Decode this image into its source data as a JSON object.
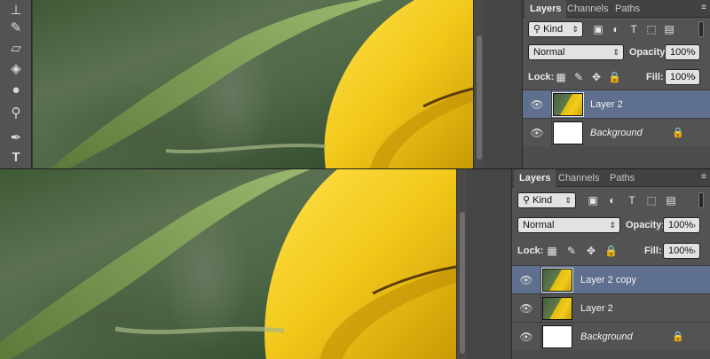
{
  "top_view": {
    "tools": [
      {
        "name": "stamp-icon",
        "glyph": "⊥"
      },
      {
        "name": "history-brush-icon",
        "glyph": "✎"
      },
      {
        "name": "eraser-icon",
        "glyph": "▱"
      },
      {
        "name": "paint-bucket-icon",
        "glyph": "⛽"
      },
      {
        "name": "blur-icon",
        "glyph": "💧"
      },
      {
        "name": "dodge-icon",
        "glyph": "🔍"
      },
      {
        "name": "pen-icon",
        "glyph": "✒"
      },
      {
        "name": "type-icon",
        "glyph": "T"
      }
    ],
    "layers_panel": {
      "tabs": [
        "Layers",
        "Channels",
        "Paths"
      ],
      "filter_label": "Kind",
      "blend_mode": "Normal",
      "opacity_label": "Opacity:",
      "opacity_value": "100%",
      "lock_label": "Lock:",
      "fill_label": "Fill:",
      "fill_value": "100%",
      "layers": [
        {
          "name": "Layer 2",
          "selected": true,
          "thumbnail": "photo",
          "italic": false,
          "locked": false
        },
        {
          "name": "Background",
          "selected": false,
          "thumbnail": "white",
          "italic": true,
          "locked": true
        }
      ]
    }
  },
  "bottom_view": {
    "layers_panel": {
      "tabs": [
        "Layers",
        "Channels",
        "Paths"
      ],
      "filter_label": "Kind",
      "blend_mode": "Normal",
      "opacity_label": "Opacity:",
      "opacity_value": "100%",
      "lock_label": "Lock:",
      "fill_label": "Fill:",
      "fill_value": "100%",
      "layers": [
        {
          "name": "Layer 2 copy",
          "selected": true,
          "thumbnail": "photo",
          "italic": false,
          "locked": false
        },
        {
          "name": "Layer 2",
          "selected": false,
          "thumbnail": "photo",
          "italic": false,
          "locked": false
        },
        {
          "name": "Background",
          "selected": false,
          "thumbnail": "white",
          "italic": true,
          "locked": true
        }
      ]
    }
  },
  "colors": {
    "panel_bg": "#535353",
    "selected_layer": "#5f708e",
    "petal_yellow": "#f2c81a",
    "leaf_green": "#7d9a55"
  },
  "icons": {
    "eye": "eye-icon",
    "lock": "lock-icon",
    "search": "search-icon",
    "panel_menu": "panel-menu-icon"
  }
}
